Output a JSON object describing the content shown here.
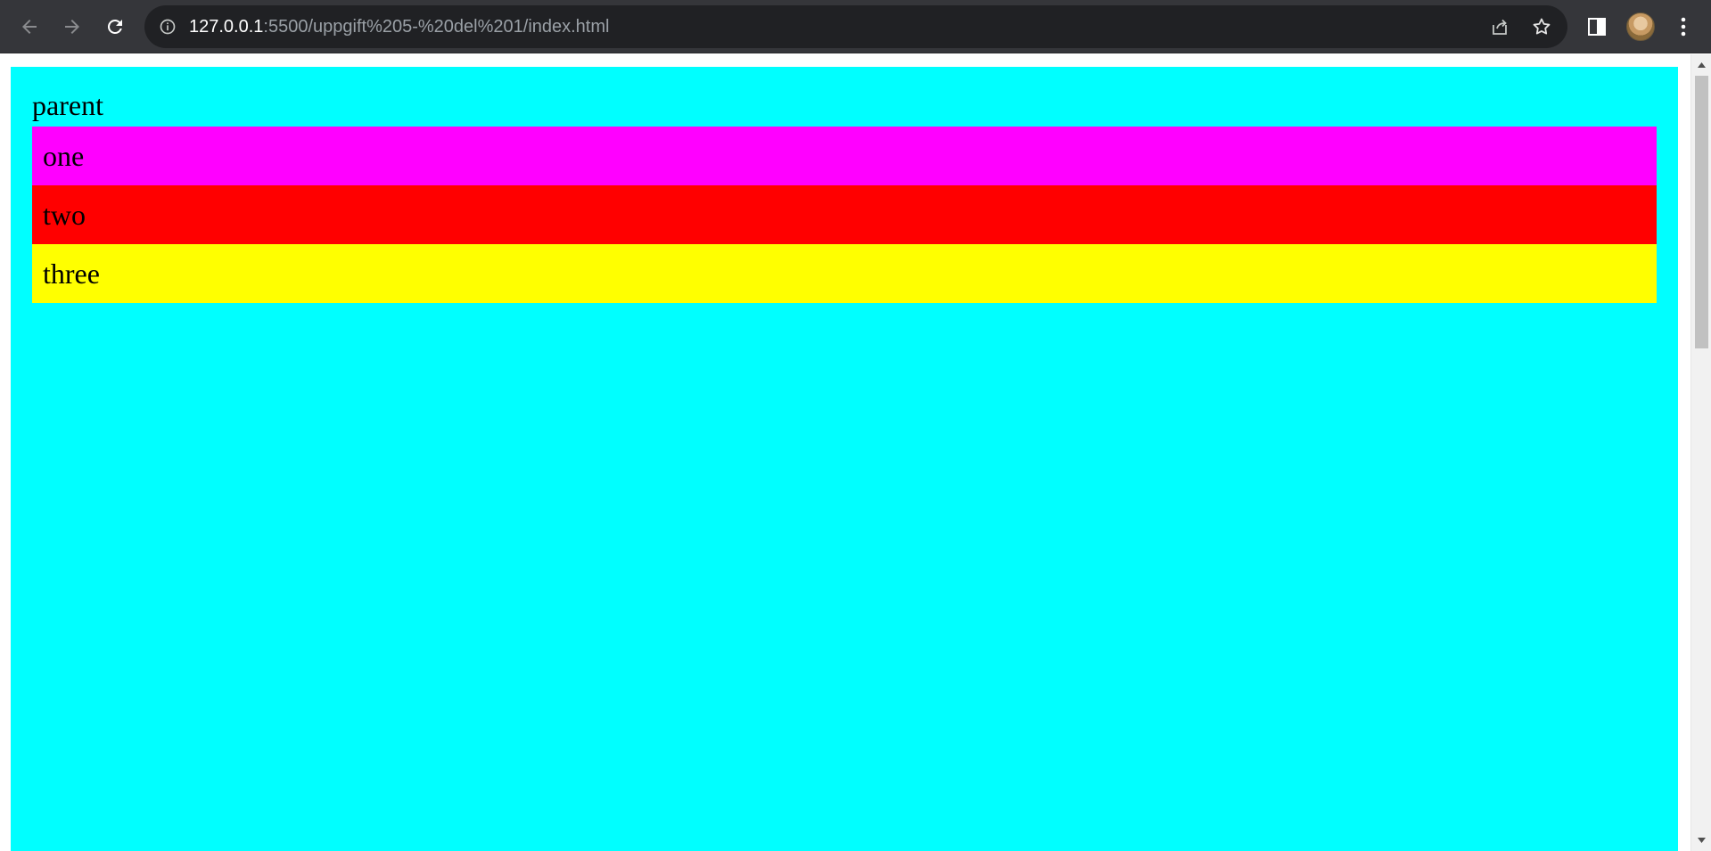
{
  "browser": {
    "url_host": "127.0.0.1",
    "url_path": ":5500/uppgift%205-%20del%201/index.html",
    "icons": {
      "back": "arrow-left-icon",
      "forward": "arrow-right-icon",
      "reload": "reload-icon",
      "site_info": "info-icon",
      "share": "share-icon",
      "bookmark": "star-icon",
      "side_panel": "side-panel-icon",
      "profile": "avatar",
      "menu": "kebab-menu-icon"
    }
  },
  "page": {
    "parent_label": "parent",
    "children": [
      {
        "label": "one",
        "color": "#ff00ff"
      },
      {
        "label": "two",
        "color": "#ff0000"
      },
      {
        "label": "three",
        "color": "#ffff00"
      }
    ],
    "parent_color": "#00ffff"
  }
}
